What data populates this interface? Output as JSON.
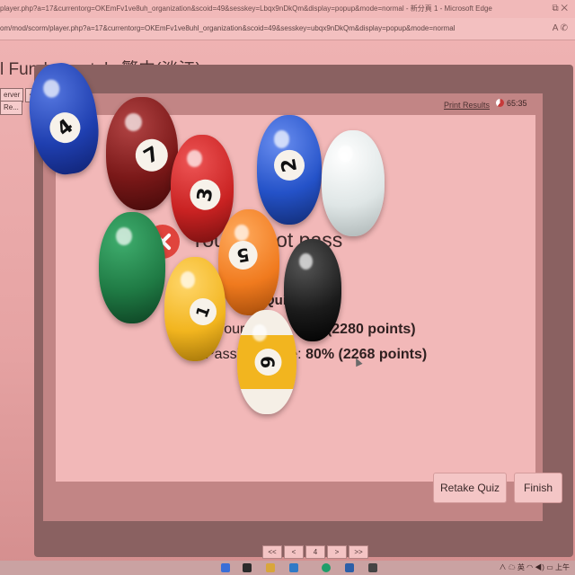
{
  "browser": {
    "title_url": "player.php?a=17&currentorg=OKEmFv1ve8uh_organization&scoid=49&sesskey=Lbqx9nDkQm&display=popup&mode=normal - 新分頁 1 - Microsoft Edge",
    "address_url": "om/mod/scorm/player.php?a=17&currentorg=OKEmFv1ve8uhl_organization&scoid=49&sesskey=ubqx9nDkQm&display=popup&mode=normal",
    "window_controls": "⧉  ✕",
    "toolbar_icons": "A  ✆"
  },
  "page": {
    "heading": "l Fundamentals 繁中(淡江)",
    "side_button_1": "erver",
    "side_button_2": "Re...",
    "side_arrow": "<"
  },
  "player": {
    "print_results": "Print Results",
    "timer": "65:35"
  },
  "result": {
    "title": "You did not pass",
    "quiz_label": "Quiz",
    "score_label": "Your Score:",
    "score_value": "71% (2280 points)",
    "passing_label": "Passing Score:",
    "passing_value": "80% (2268 points)"
  },
  "buttons": {
    "retake": "Retake Quiz",
    "finish": "Finish"
  },
  "pager": {
    "first": "<<",
    "prev": "<",
    "page": "4",
    "next": ">",
    "last": ">>"
  },
  "tray": {
    "text": "∧  ☁  英  ◠  ◀)  ▭",
    "time": "上午"
  },
  "colors": {
    "fail_icon": "#e0443d",
    "screen_tint": "#f2b8b8",
    "frame": "#8a6161"
  },
  "balls": [
    {
      "number": "4",
      "color": "#1f3fb0",
      "striped": false
    },
    {
      "number": "7",
      "color": "#7a1818",
      "striped": false
    },
    {
      "number": "3",
      "color": "#c92222",
      "striped": false
    },
    {
      "number": "2",
      "color": "#2452c8",
      "striped": false
    },
    {
      "number": "",
      "color": "#eef2f2",
      "striped": false
    },
    {
      "number": "",
      "color": "#1f7a44",
      "striped": false
    },
    {
      "number": "5",
      "color": "#f07a1e",
      "striped": false
    },
    {
      "number": "1",
      "color": "#f2b51f",
      "striped": false
    },
    {
      "number": "",
      "color": "#1b1b1b",
      "striped": false
    },
    {
      "number": "9",
      "color": "#f2b51f",
      "striped": true
    }
  ]
}
